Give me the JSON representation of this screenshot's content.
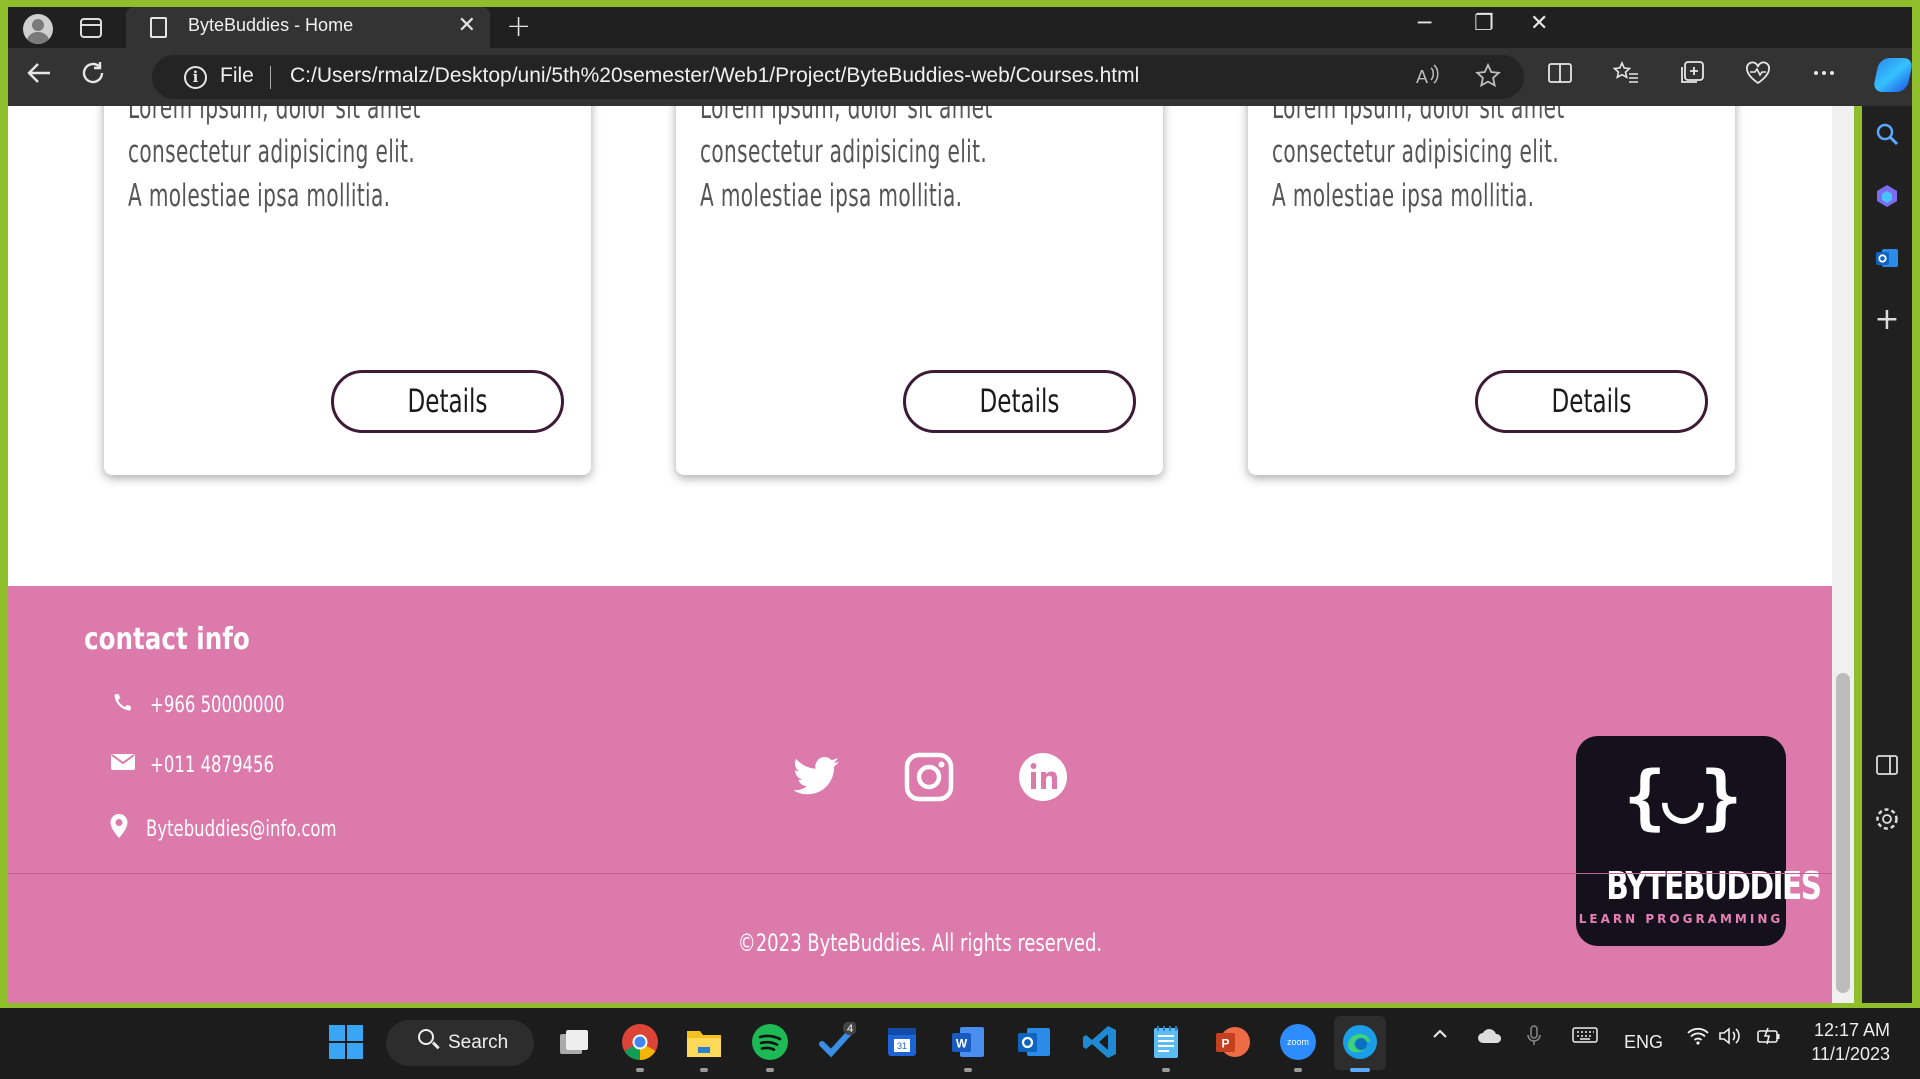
{
  "browser": {
    "tab_title": "ByteBuddies - Home",
    "tab_close": "✕",
    "new_tab": "+",
    "file_label": "File",
    "url": "C:/Users/rmalz/Desktop/uni/5th%20semester/Web1/Project/ByteBuddies-web/Courses.html",
    "window_controls": [
      "─",
      "❐",
      "✕"
    ]
  },
  "cards": [
    {
      "lines": [
        "Lorem ipsum, dolor sit amet",
        "consectetur adipisicing elit.",
        "A molestiae ipsa mollitia."
      ],
      "button": "Details"
    },
    {
      "lines": [
        "Lorem ipsum, dolor sit amet",
        "consectetur adipisicing elit.",
        "A molestiae ipsa mollitia."
      ],
      "button": "Details"
    },
    {
      "lines": [
        "Lorem ipsum, dolor sit amet",
        "consectetur adipisicing elit.",
        "A molestiae ipsa mollitia."
      ],
      "button": "Details"
    }
  ],
  "footer": {
    "contact_title": "contact info",
    "phone": "+966 50000000",
    "fax": "+011 4879456",
    "email": "Bytebuddies@info.com",
    "social": [
      "twitter-icon",
      "instagram-icon",
      "linkedin-icon"
    ],
    "logo": {
      "face": "{◡}",
      "title": "BYTEBUDDIES",
      "subtitle": "LEARN PROGRAMMING"
    },
    "copyright": "©2023 ByteBuddies. All rights reserved."
  },
  "taskbar": {
    "search_label": "Search",
    "language": "ENG",
    "time": "12:17 AM",
    "date": "11/1/2023",
    "badge": "4"
  },
  "colors": {
    "footer_bg": "#db7aab",
    "button_border": "#3d1a36",
    "logo_bg": "#15111c"
  }
}
